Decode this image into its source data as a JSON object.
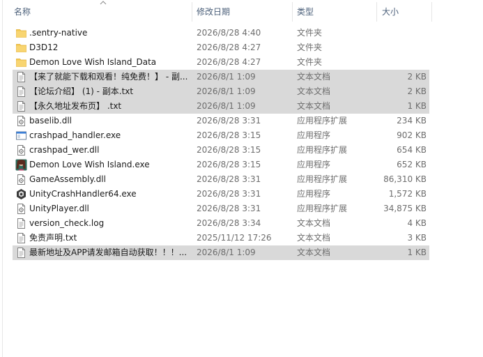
{
  "columns": {
    "name": "名称",
    "date": "修改日期",
    "type": "类型",
    "size": "大小"
  },
  "files": [
    {
      "name": ".sentry-native",
      "date": "2026/8/28 4:40",
      "type": "文件夹",
      "size": "",
      "icon": "folder-icon",
      "selected": false
    },
    {
      "name": "D3D12",
      "date": "2026/8/28 4:27",
      "type": "文件夹",
      "size": "",
      "icon": "folder-icon",
      "selected": false
    },
    {
      "name": "Demon Love Wish Island_Data",
      "date": "2026/8/28 4:27",
      "type": "文件夹",
      "size": "",
      "icon": "folder-icon",
      "selected": false
    },
    {
      "name": "【来了就能下载和观看！纯免费！】 - 副...",
      "date": "2026/8/1 1:09",
      "type": "文本文档",
      "size": "2 KB",
      "icon": "text-file-icon",
      "selected": true
    },
    {
      "name": "【论坛介绍】 (1) - 副本.txt",
      "date": "2026/8/1 1:09",
      "type": "文本文档",
      "size": "2 KB",
      "icon": "text-file-icon",
      "selected": true
    },
    {
      "name": "【永久地址发布页】 .txt",
      "date": "2026/8/1 1:09",
      "type": "文本文档",
      "size": "1 KB",
      "icon": "text-file-icon",
      "selected": true
    },
    {
      "name": "baselib.dll",
      "date": "2026/8/28 3:31",
      "type": "应用程序扩展",
      "size": "234 KB",
      "icon": "dll-file-icon",
      "selected": false
    },
    {
      "name": "crashpad_handler.exe",
      "date": "2026/8/28 3:15",
      "type": "应用程序",
      "size": "902 KB",
      "icon": "exe-window-icon",
      "selected": false
    },
    {
      "name": "crashpad_wer.dll",
      "date": "2026/8/28 3:15",
      "type": "应用程序扩展",
      "size": "654 KB",
      "icon": "dll-file-icon",
      "selected": false
    },
    {
      "name": "Demon Love Wish Island.exe",
      "date": "2026/8/28 3:15",
      "type": "应用程序",
      "size": "652 KB",
      "icon": "game-app-icon",
      "selected": false
    },
    {
      "name": "GameAssembly.dll",
      "date": "2026/8/28 3:31",
      "type": "应用程序扩展",
      "size": "86,310 KB",
      "icon": "dll-file-icon",
      "selected": false
    },
    {
      "name": "UnityCrashHandler64.exe",
      "date": "2026/8/28 3:31",
      "type": "应用程序",
      "size": "1,572 KB",
      "icon": "unity-app-icon",
      "selected": false
    },
    {
      "name": "UnityPlayer.dll",
      "date": "2026/8/28 3:31",
      "type": "应用程序扩展",
      "size": "34,875 KB",
      "icon": "dll-file-icon",
      "selected": false
    },
    {
      "name": "version_check.log",
      "date": "2026/8/28 3:34",
      "type": "文本文档",
      "size": "4 KB",
      "icon": "text-file-icon",
      "selected": false
    },
    {
      "name": "免责声明.txt",
      "date": "2025/11/12 17:26",
      "type": "文本文档",
      "size": "3 KB",
      "icon": "text-file-icon",
      "selected": false
    },
    {
      "name": "最新地址及APP请发邮箱自动获取！！！...",
      "date": "2026/8/1 1:09",
      "type": "文本文档",
      "size": "1 KB",
      "icon": "text-file-icon",
      "selected": true
    }
  ],
  "colors": {
    "header_text": "#4c607a",
    "selection": "#d9d9d9",
    "folder": "#f4c84e",
    "secondary_text": "#6d6d6d"
  }
}
